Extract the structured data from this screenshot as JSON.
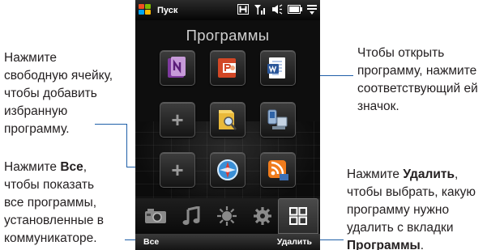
{
  "status_bar": {
    "start_label": "Пуск",
    "icons": [
      "windows-flag-icon",
      "h-network-icon",
      "signal-icon",
      "speaker-icon",
      "battery-icon",
      "menu-icon"
    ]
  },
  "screen_title": "Программы",
  "tiles": [
    {
      "icon": "onenote-icon"
    },
    {
      "icon": "powerpoint-icon"
    },
    {
      "icon": "word-icon"
    },
    {
      "icon": "plus-icon",
      "text": "+"
    },
    {
      "icon": "file-explorer-icon"
    },
    {
      "icon": "sync-device-icon"
    },
    {
      "icon": "plus-icon",
      "text": "+"
    },
    {
      "icon": "internet-explorer-icon"
    },
    {
      "icon": "rss-icon"
    }
  ],
  "tabs": [
    "camera-icon",
    "music-icon",
    "weather-icon",
    "settings-icon",
    "programs-icon"
  ],
  "softkeys": {
    "left": "Все",
    "right": "Удалить"
  },
  "callouts": {
    "left_top": [
      "Нажмите",
      "свободную ячейку,",
      "чтобы добавить",
      "избранную",
      "программу."
    ],
    "left_bottom": {
      "line1_pre": "Нажмите ",
      "line1_bold": "Все",
      "line1_post": ",",
      "rest": [
        "чтобы показать",
        "все программы,",
        "установленные в",
        "коммуникаторе."
      ]
    },
    "right_top": [
      "Чтобы открыть",
      "программу, нажмите",
      "соответствующий ей",
      "значок."
    ],
    "right_bottom": {
      "line1_pre": "Нажмите ",
      "line1_bold": "Удалить",
      "line1_post": ",",
      "rest": [
        "чтобы выбрать, какую",
        "программу нужно",
        "удалить с вкладки"
      ],
      "last_bold": "Программы",
      "last_post": "."
    }
  },
  "colors": {
    "leader_line": "#1f5fa8",
    "screen_bg": "#0e0e0e"
  }
}
